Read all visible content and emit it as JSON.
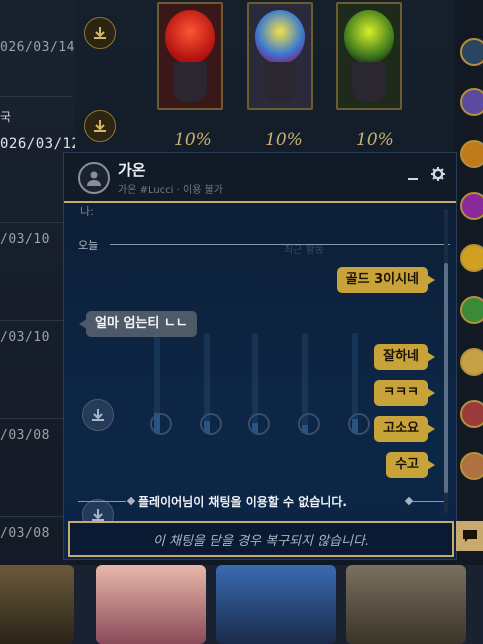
{
  "history": {
    "label": "국",
    "dates": [
      "026/03/14",
      "026/03/12",
      "/03/10",
      "/03/10",
      "/03/08",
      "/03/08"
    ]
  },
  "rewards": {
    "percents": [
      "10%",
      "10%",
      "10%"
    ]
  },
  "chat": {
    "name": "가온",
    "subtitle": "가온 #Lucci · 이용 불가",
    "partial_top": "나:",
    "day_label": "오늘",
    "ghost_heading": "최근 활동",
    "messages": [
      {
        "from": "me",
        "text": "골드 3이시네"
      },
      {
        "from": "them",
        "text": "얼마 엄는티 ㄴㄴ"
      },
      {
        "from": "me",
        "text": "잘하네"
      },
      {
        "from": "me",
        "text": "ㅋㅋㅋ"
      },
      {
        "from": "me",
        "text": "고소요"
      },
      {
        "from": "me",
        "text": "수고"
      }
    ],
    "notice": "플레이어님이 채팅을 이용할 수 없습니다.",
    "close_warning": "이 채팅을 닫을 경우 복구되지 않습니다."
  },
  "colors": {
    "accent_gold": "#c8aa6e",
    "my_bubble": "#c8a33a",
    "their_bubble": "#4f5a68",
    "chat_bg": "#0d2645"
  },
  "icons": {
    "download": "download-icon",
    "avatar": "user-avatar-icon",
    "minimize": "minimize-icon",
    "settings": "gear-icon",
    "chat_toggle": "chat-bubble-icon"
  }
}
